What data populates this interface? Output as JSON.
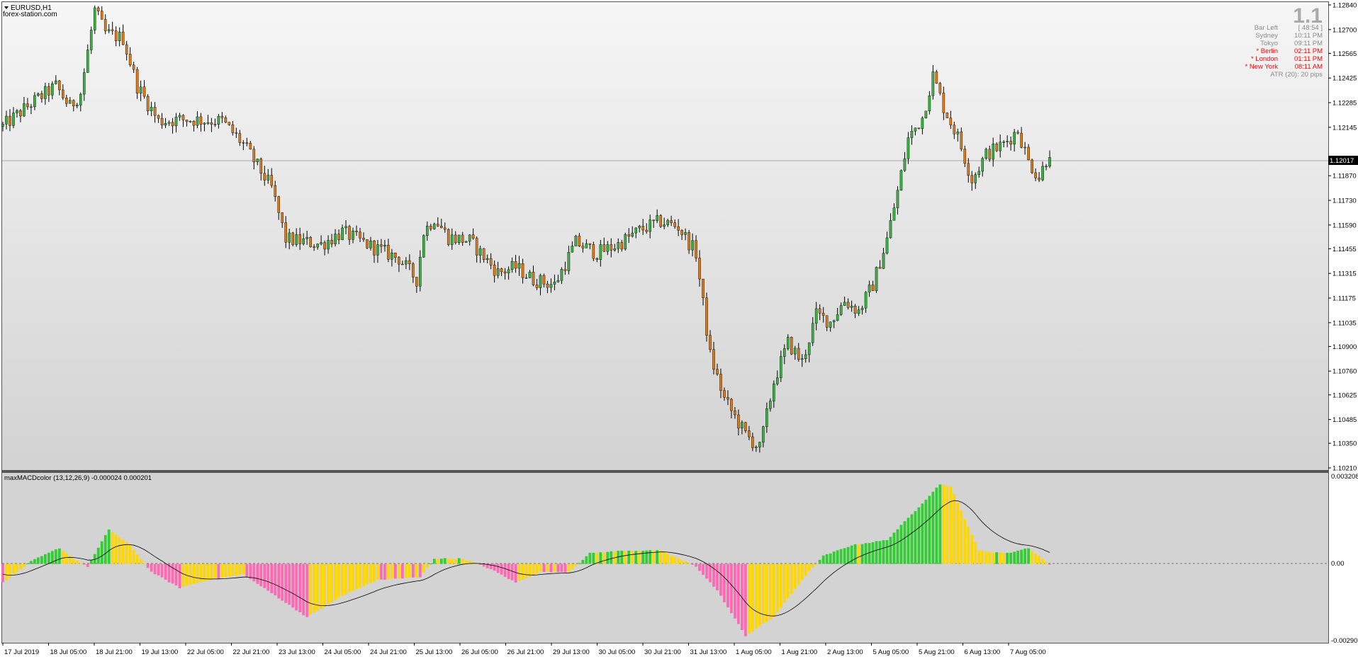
{
  "header": {
    "symbol_label": "EURUSD,H1",
    "site_label": "forex-station.com",
    "big_value": "1.1"
  },
  "info_panel": {
    "rows": [
      {
        "label": "Bar Left",
        "value": "[ 48:54 ]",
        "color": "#8a8a8a"
      },
      {
        "label": "Sydney",
        "value": "10:11 PM",
        "color": "#8a8a8a"
      },
      {
        "label": "Tokyo",
        "value": "09:11 PM",
        "color": "#8a8a8a"
      },
      {
        "label": "* Berlin",
        "value": "02:11 PM",
        "color": "#ff0000"
      },
      {
        "label": "* London",
        "value": "01:11 PM",
        "color": "#ff0000"
      },
      {
        "label": "* New York",
        "value": "08:11 AM",
        "color": "#ff0000"
      }
    ],
    "atr_text": "ATR (20): 20 pips"
  },
  "price_chart": {
    "y_ticks": [
      "1.12840",
      "1.12700",
      "1.12565",
      "1.12425",
      "1.12285",
      "1.12145",
      "1.12017",
      "1.11870",
      "1.11730",
      "1.11590",
      "1.11455",
      "1.11315",
      "1.11175",
      "1.11035",
      "1.10900",
      "1.10760",
      "1.10625",
      "1.10485",
      "1.10350",
      "1.10210"
    ],
    "current_price": "1.12017",
    "ylim": [
      1.1021,
      1.1284
    ]
  },
  "indicator": {
    "label": "maxMACDcolor (13,12,26,9) -0.000024 0.000201",
    "y_ticks": [
      "0.003208",
      "0.00",
      "-0.002909"
    ],
    "ylim": [
      -0.002909,
      0.003208
    ]
  },
  "x_axis": {
    "labels": [
      "17 Jul 2019",
      "18 Jul 05:00",
      "18 Jul 21:00",
      "19 Jul 13:00",
      "22 Jul 05:00",
      "22 Jul 21:00",
      "23 Jul 13:00",
      "24 Jul 05:00",
      "24 Jul 21:00",
      "25 Jul 13:00",
      "26 Jul 05:00",
      "26 Jul 21:00",
      "29 Jul 13:00",
      "30 Jul 05:00",
      "30 Jul 21:00",
      "31 Jul 13:00",
      "1 Aug 05:00",
      "1 Aug 21:00",
      "2 Aug 13:00",
      "5 Aug 05:00",
      "5 Aug 21:00",
      "6 Aug 13:00",
      "7 Aug 05:00"
    ]
  },
  "colors": {
    "bull_candle": "#3cb043",
    "bear_candle": "#d97a1a",
    "wick": "#000000",
    "hist_green": "#32cd32",
    "hist_yellow": "#ffd700",
    "hist_pink": "#ff69b4",
    "signal_line": "#000000",
    "background_top": "#f6f6f6",
    "background_bottom": "#d2d2d2",
    "price_line": "#a9a9a9"
  },
  "chart_data": [
    {
      "type": "candlestick",
      "title": "EURUSD,H1",
      "ylim": [
        1.1021,
        1.1284
      ],
      "anchor_closes": [
        {
          "i": 0,
          "v": 1.1215
        },
        {
          "i": 8,
          "v": 1.1228
        },
        {
          "i": 15,
          "v": 1.1238
        },
        {
          "i": 19,
          "v": 1.1226
        },
        {
          "i": 22,
          "v": 1.1234
        },
        {
          "i": 26,
          "v": 1.1281
        },
        {
          "i": 29,
          "v": 1.1268
        },
        {
          "i": 34,
          "v": 1.1265
        },
        {
          "i": 38,
          "v": 1.1238
        },
        {
          "i": 44,
          "v": 1.1218
        },
        {
          "i": 52,
          "v": 1.1219
        },
        {
          "i": 62,
          "v": 1.1218
        },
        {
          "i": 68,
          "v": 1.1205
        },
        {
          "i": 76,
          "v": 1.118
        },
        {
          "i": 80,
          "v": 1.1151
        },
        {
          "i": 90,
          "v": 1.1148
        },
        {
          "i": 96,
          "v": 1.1155
        },
        {
          "i": 104,
          "v": 1.1147
        },
        {
          "i": 112,
          "v": 1.114
        },
        {
          "i": 117,
          "v": 1.1128
        },
        {
          "i": 119,
          "v": 1.1155
        },
        {
          "i": 122,
          "v": 1.1163
        },
        {
          "i": 126,
          "v": 1.1152
        },
        {
          "i": 132,
          "v": 1.115
        },
        {
          "i": 140,
          "v": 1.1132
        },
        {
          "i": 145,
          "v": 1.1135
        },
        {
          "i": 150,
          "v": 1.1128
        },
        {
          "i": 156,
          "v": 1.1125
        },
        {
          "i": 162,
          "v": 1.1149
        },
        {
          "i": 168,
          "v": 1.1143
        },
        {
          "i": 174,
          "v": 1.1148
        },
        {
          "i": 180,
          "v": 1.1156
        },
        {
          "i": 186,
          "v": 1.1161
        },
        {
          "i": 191,
          "v": 1.1158
        },
        {
          "i": 196,
          "v": 1.1143
        },
        {
          "i": 200,
          "v": 1.1085
        },
        {
          "i": 204,
          "v": 1.106
        },
        {
          "i": 210,
          "v": 1.104
        },
        {
          "i": 214,
          "v": 1.1032
        },
        {
          "i": 218,
          "v": 1.107
        },
        {
          "i": 222,
          "v": 1.1092
        },
        {
          "i": 226,
          "v": 1.1081
        },
        {
          "i": 230,
          "v": 1.1108
        },
        {
          "i": 234,
          "v": 1.1104
        },
        {
          "i": 238,
          "v": 1.1116
        },
        {
          "i": 242,
          "v": 1.111
        },
        {
          "i": 246,
          "v": 1.1125
        },
        {
          "i": 250,
          "v": 1.1151
        },
        {
          "i": 253,
          "v": 1.1178
        },
        {
          "i": 256,
          "v": 1.1208
        },
        {
          "i": 260,
          "v": 1.122
        },
        {
          "i": 263,
          "v": 1.1244
        },
        {
          "i": 266,
          "v": 1.1226
        },
        {
          "i": 270,
          "v": 1.1209
        },
        {
          "i": 274,
          "v": 1.1185
        },
        {
          "i": 278,
          "v": 1.1199
        },
        {
          "i": 283,
          "v": 1.1205
        },
        {
          "i": 287,
          "v": 1.1213
        },
        {
          "i": 290,
          "v": 1.1195
        },
        {
          "i": 293,
          "v": 1.1186
        },
        {
          "i": 296,
          "v": 1.1201
        }
      ]
    },
    {
      "type": "bar",
      "title": "maxMACDcolor (13,12,26,9)",
      "ylim": [
        -0.002909,
        0.003208
      ],
      "anchor_values": [
        {
          "i": 0,
          "v": -0.0007
        },
        {
          "i": 8,
          "v": 0.0001
        },
        {
          "i": 16,
          "v": 0.0006
        },
        {
          "i": 20,
          "v": 0.0002
        },
        {
          "i": 24,
          "v": -0.0001
        },
        {
          "i": 30,
          "v": 0.0013
        },
        {
          "i": 36,
          "v": 0.0007
        },
        {
          "i": 42,
          "v": -0.0003
        },
        {
          "i": 50,
          "v": -0.0009
        },
        {
          "i": 58,
          "v": -0.0006
        },
        {
          "i": 68,
          "v": -0.0004
        },
        {
          "i": 76,
          "v": -0.0011
        },
        {
          "i": 86,
          "v": -0.002
        },
        {
          "i": 96,
          "v": -0.0012
        },
        {
          "i": 106,
          "v": -0.0006
        },
        {
          "i": 118,
          "v": -0.0005
        },
        {
          "i": 122,
          "v": 0.0002
        },
        {
          "i": 130,
          "v": 0.0002
        },
        {
          "i": 138,
          "v": -0.0002
        },
        {
          "i": 145,
          "v": -0.0007
        },
        {
          "i": 152,
          "v": -0.0003
        },
        {
          "i": 160,
          "v": -0.0003
        },
        {
          "i": 166,
          "v": 0.0004
        },
        {
          "i": 176,
          "v": 0.0005
        },
        {
          "i": 186,
          "v": 0.0005
        },
        {
          "i": 196,
          "v": -0.0001
        },
        {
          "i": 202,
          "v": -0.001
        },
        {
          "i": 210,
          "v": -0.0027
        },
        {
          "i": 218,
          "v": -0.002
        },
        {
          "i": 226,
          "v": -0.0006
        },
        {
          "i": 232,
          "v": 0.0003
        },
        {
          "i": 240,
          "v": 0.0007
        },
        {
          "i": 250,
          "v": 0.0009
        },
        {
          "i": 258,
          "v": 0.002
        },
        {
          "i": 265,
          "v": 0.003
        },
        {
          "i": 268,
          "v": 0.0029
        },
        {
          "i": 276,
          "v": 0.0005
        },
        {
          "i": 284,
          "v": 0.0004
        },
        {
          "i": 290,
          "v": 0.0006
        },
        {
          "i": 296,
          "v": -2e-05
        }
      ]
    }
  ]
}
